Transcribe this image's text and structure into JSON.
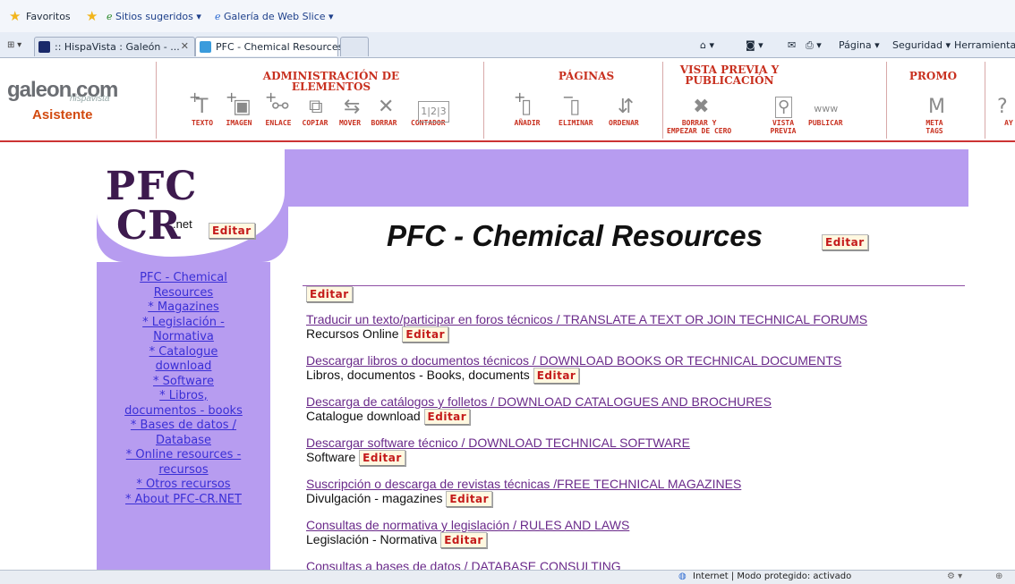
{
  "favorites_bar": {
    "favorites": "Favoritos",
    "suggested": "Sitios sugeridos ▾",
    "web_slice": "Galería de Web Slice ▾"
  },
  "tabs": [
    {
      "label": ":: HispaVista : Galeón - ...",
      "active": false
    },
    {
      "label": "PFC - Chemical Resources",
      "active": true
    }
  ],
  "ie_commands": {
    "page": "Página ▾",
    "security": "Seguridad ▾",
    "tools": "Herramientas"
  },
  "galeon": {
    "logo_text": "galeon.com",
    "logo_sub": "hispavista",
    "assistant": "Asistente",
    "groups": {
      "admin": "ADMINISTRACIÓN DE ELEMENTOS",
      "pages": "PÁGINAS",
      "preview_line1": "VISTA PREVIA Y",
      "preview_line2": "PUBLICACIÓN",
      "promo": "PROMO"
    },
    "tools": {
      "texto": "TEXTO",
      "imagen": "IMAGEN",
      "enlace": "ENLACE",
      "copiar": "COPIAR",
      "mover": "MOVER",
      "borrar": "BORRAR",
      "contador": "CONTADOR",
      "anadir": "AÑADIR",
      "eliminar": "ELIMINAR",
      "ordenar": "ORDENAR",
      "borrar_y1": "BORRAR Y",
      "borrar_y2": "EMPEZAR DE CERO",
      "vista1": "VISTA",
      "vista2": "PREVIA",
      "publicar": "PUBLICAR",
      "meta1": "META",
      "meta2": "TAGS",
      "ayuda": "AY"
    }
  },
  "site": {
    "logo_pfc": "PFC",
    "logo_cr": "CR",
    "logo_net": ".net",
    "edit_label": "Editar",
    "title": "PFC - Chemical Resources",
    "nav": [
      "PFC - Chemical",
      "Resources",
      "* Magazines",
      "* Legislación -",
      "Normativa",
      "* Catalogue",
      "download",
      "* Software",
      "* Libros,",
      "documentos - books",
      "* Bases de datos /",
      "Database",
      "* Online resources -",
      "recursos",
      "* Otros recursos",
      "* About PFC-CR.NET"
    ],
    "items": [
      {
        "link": "Traducir un texto/participar en foros técnicos / TRANSLATE A TEXT OR JOIN TECHNICAL FORUMS",
        "sub": "Recursos Online"
      },
      {
        "link": "Descargar libros o documentos técnicos / DOWNLOAD BOOKS OR TECHNICAL DOCUMENTS",
        "sub": "Libros, documentos - Books, documents"
      },
      {
        "link": "Descarga de catálogos y folletos / DOWNLOAD CATALOGUES AND BROCHURES",
        "sub": "Catalogue download"
      },
      {
        "link": "Descargar software técnico / DOWNLOAD TECHNICAL SOFTWARE",
        "sub": "Software"
      },
      {
        "link": "Suscripción o descarga de revistas técnicas /FREE TECHNICAL MAGAZINES",
        "sub": "Divulgación - magazines"
      },
      {
        "link": "Consultas de normativa y legislación / RULES AND LAWS",
        "sub": "Legislación - Normativa"
      },
      {
        "link": "Consultas a bases de datos / DATABASE CONSULTING",
        "sub": ""
      }
    ]
  },
  "status_bar": {
    "zone": "Internet | Modo protegido: activado"
  },
  "colors": {
    "purple": "#b79cf0",
    "accent_red": "#c8301f",
    "link": "#6a2a8a"
  }
}
